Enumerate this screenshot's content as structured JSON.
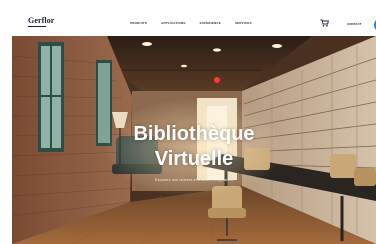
{
  "brand": {
    "logo_text": "Gerflor",
    "accent_color": "#1e88e5"
  },
  "nav": {
    "links": [
      {
        "label": "PRODUITS"
      },
      {
        "label": "APPLICATIONS"
      },
      {
        "label": "EXPERIENCE"
      },
      {
        "label": "SERVICES"
      }
    ],
    "cart_icon": "cart-icon",
    "account_label": "CONTACT",
    "action_icon": "plus-icon"
  },
  "hero": {
    "title_line1": "Bibliothèque",
    "title_line2": "Virtuelle",
    "subtitle": "Explorez nos univers et trouvez l'inspiration"
  }
}
